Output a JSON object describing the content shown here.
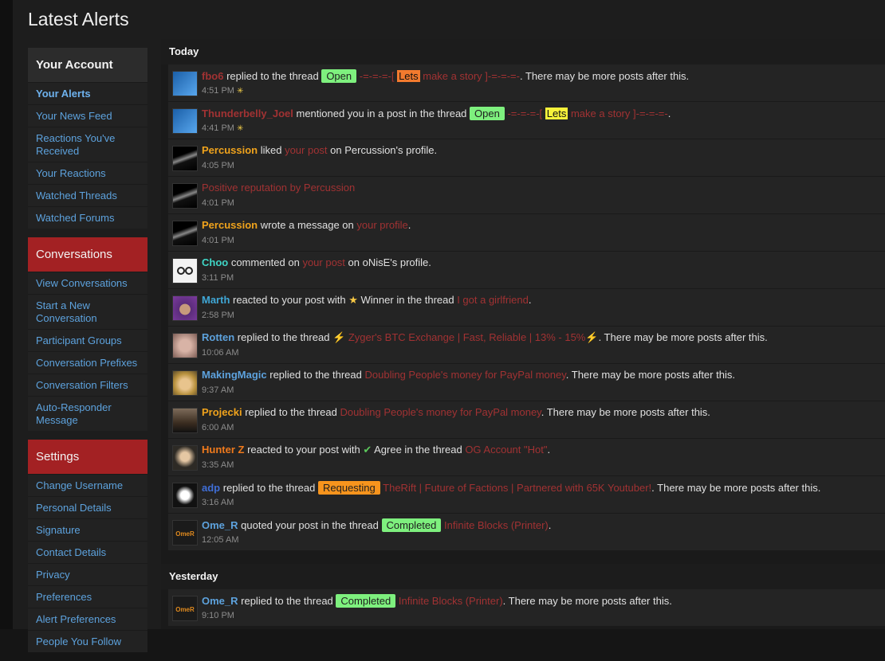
{
  "page": {
    "title": "Latest Alerts"
  },
  "colors": {
    "page_bg": "#1d1d1d",
    "panel_bg": "#242424",
    "link_red": "#a13233",
    "sidebar_link": "#5da2dd",
    "header_red": "#a32123",
    "prefix_open": "#7ef07e",
    "prefix_requesting": "#f7941d",
    "prefix_completed": "#7ef07e"
  },
  "sidebar": {
    "account": {
      "title": "Your Account",
      "items": [
        "Your Alerts",
        "Your News Feed",
        "Reactions You've Received",
        "Your Reactions",
        "Watched Threads",
        "Watched Forums"
      ]
    },
    "conversations": {
      "title": "Conversations",
      "items": [
        "View Conversations",
        "Start a New Conversation",
        "Participant Groups",
        "Conversation Prefixes",
        "Conversation Filters",
        "Auto-Responder Message"
      ]
    },
    "settings": {
      "title": "Settings",
      "items": [
        "Change Username",
        "Personal Details",
        "Signature",
        "Contact Details",
        "Privacy",
        "Preferences",
        "Alert Preferences",
        "People You Follow"
      ]
    }
  },
  "today": {
    "heading": "Today",
    "alerts": [
      {
        "user": "fbo6",
        "user_color": "#a13233",
        "avatar": "blue-cube-avatar",
        "text1": " replied to the thread ",
        "prefix": "Open",
        "prefix_color": "#7ef07e",
        "link_pre": " -=-=-=-[ ",
        "hl": "Lets",
        "hl_color": "#f37a2e",
        "link_post": " make a story ]-=-=-=-",
        "text2": ". There may be more posts after this.",
        "time": "4:51 PM",
        "new_icon": "✳"
      },
      {
        "user": "Thunderbelly_Joel",
        "user_color": "#a13233",
        "avatar": "blue-cube-avatar",
        "text1": " mentioned you in a post in the thread ",
        "prefix": "Open",
        "prefix_color": "#7ef07e",
        "link_pre": " -=-=-=-[ ",
        "hl": "Lets",
        "hl_color": "#f7f23a",
        "link_post": " make a story ]-=-=-=-",
        "text2": ".",
        "time": "4:41 PM",
        "new_icon": "✳"
      },
      {
        "user": "Percussion",
        "user_color": "#f0a31c",
        "avatar": "dark-streak-avatar",
        "text1": " liked ",
        "link": "your post",
        "text2": " on Percussion's profile.",
        "time": "4:05 PM"
      },
      {
        "user": "",
        "avatar": "dark-streak-avatar",
        "link": "Positive reputation by Percussion",
        "time": "4:01 PM"
      },
      {
        "user": "Percussion",
        "user_color": "#f0a31c",
        "avatar": "dark-streak-avatar",
        "text1": " wrote a message on ",
        "link": "your profile",
        "text2": ".",
        "time": "4:01 PM"
      },
      {
        "user": "Choo",
        "user_color": "#3fd6c6",
        "avatar": "glasses-avatar",
        "text1": " commented on ",
        "link": "your post",
        "text2": " on oNisE's profile.",
        "time": "3:11 PM"
      },
      {
        "user": "Marth",
        "user_color": "#3fa7d6",
        "avatar": "purple-avatar",
        "text1": " reacted to your post with ",
        "reaction": "★",
        "reaction_color": "#f7c844",
        "reaction_name": "Winner",
        "text1b": " in the thread ",
        "link": "I got a girlfriend",
        "text2": ".",
        "time": "2:58 PM"
      },
      {
        "user": "Rotten",
        "user_color": "#5da2dd",
        "avatar": "face-avatar",
        "text1": " replied to the thread ",
        "link_icon": "⚡",
        "link": "Zyger's BTC Exchange | Fast, Reliable | 13% - 15%",
        "link_icon_after": "⚡",
        "text2": ". There may be more posts after this.",
        "time": "10:06 AM"
      },
      {
        "user": "MakingMagic",
        "user_color": "#5da2dd",
        "avatar": "blonde-avatar",
        "text1": " replied to the thread ",
        "link": "Doubling People's money for PayPal money",
        "text2": ". There may be more posts after this.",
        "time": "9:37 AM"
      },
      {
        "user": "Projecki",
        "user_color": "#f0a31c",
        "avatar": "sunset-avatar",
        "text1": " replied to the thread ",
        "link": "Doubling People's money for PayPal money",
        "text2": ". There may be more posts after this.",
        "time": "6:00 AM"
      },
      {
        "user": "Hunter Z",
        "user_color": "#f07a1c",
        "avatar": "anime-avatar",
        "text1": " reacted to your post with ",
        "reaction": "✔",
        "reaction_color": "#5cc85c",
        "reaction_name": "Agree",
        "text1b": " in the thread ",
        "link": "OG Account \"Hot\"",
        "text2": ".",
        "time": "3:35 AM"
      },
      {
        "user": "adp",
        "user_color": "#3f6ed6",
        "avatar": "white-splash-avatar",
        "text1": " replied to the thread ",
        "prefix": "Requesting",
        "prefix_color": "#f7941d",
        "link": "TheRift | Future of Factions | Partnered with 65K Youtuber!",
        "text2": ". There may be more posts after this.",
        "time": "3:16 AM"
      },
      {
        "user": "Ome_R",
        "user_color": "#5da2dd",
        "avatar": "omer-logo-avatar",
        "text1": " quoted your post in the thread ",
        "prefix": "Completed",
        "prefix_color": "#7ef07e",
        "link": "Infinite Blocks (Printer)",
        "text2": ".",
        "time": "12:05 AM"
      }
    ]
  },
  "yesterday": {
    "heading": "Yesterday",
    "alerts": [
      {
        "user": "Ome_R",
        "user_color": "#5da2dd",
        "avatar": "omer-logo-avatar",
        "text1": " replied to the thread ",
        "prefix": "Completed",
        "prefix_color": "#7ef07e",
        "link": "Infinite Blocks (Printer)",
        "text2": ". There may be more posts after this.",
        "time": "9:10 PM"
      }
    ]
  }
}
